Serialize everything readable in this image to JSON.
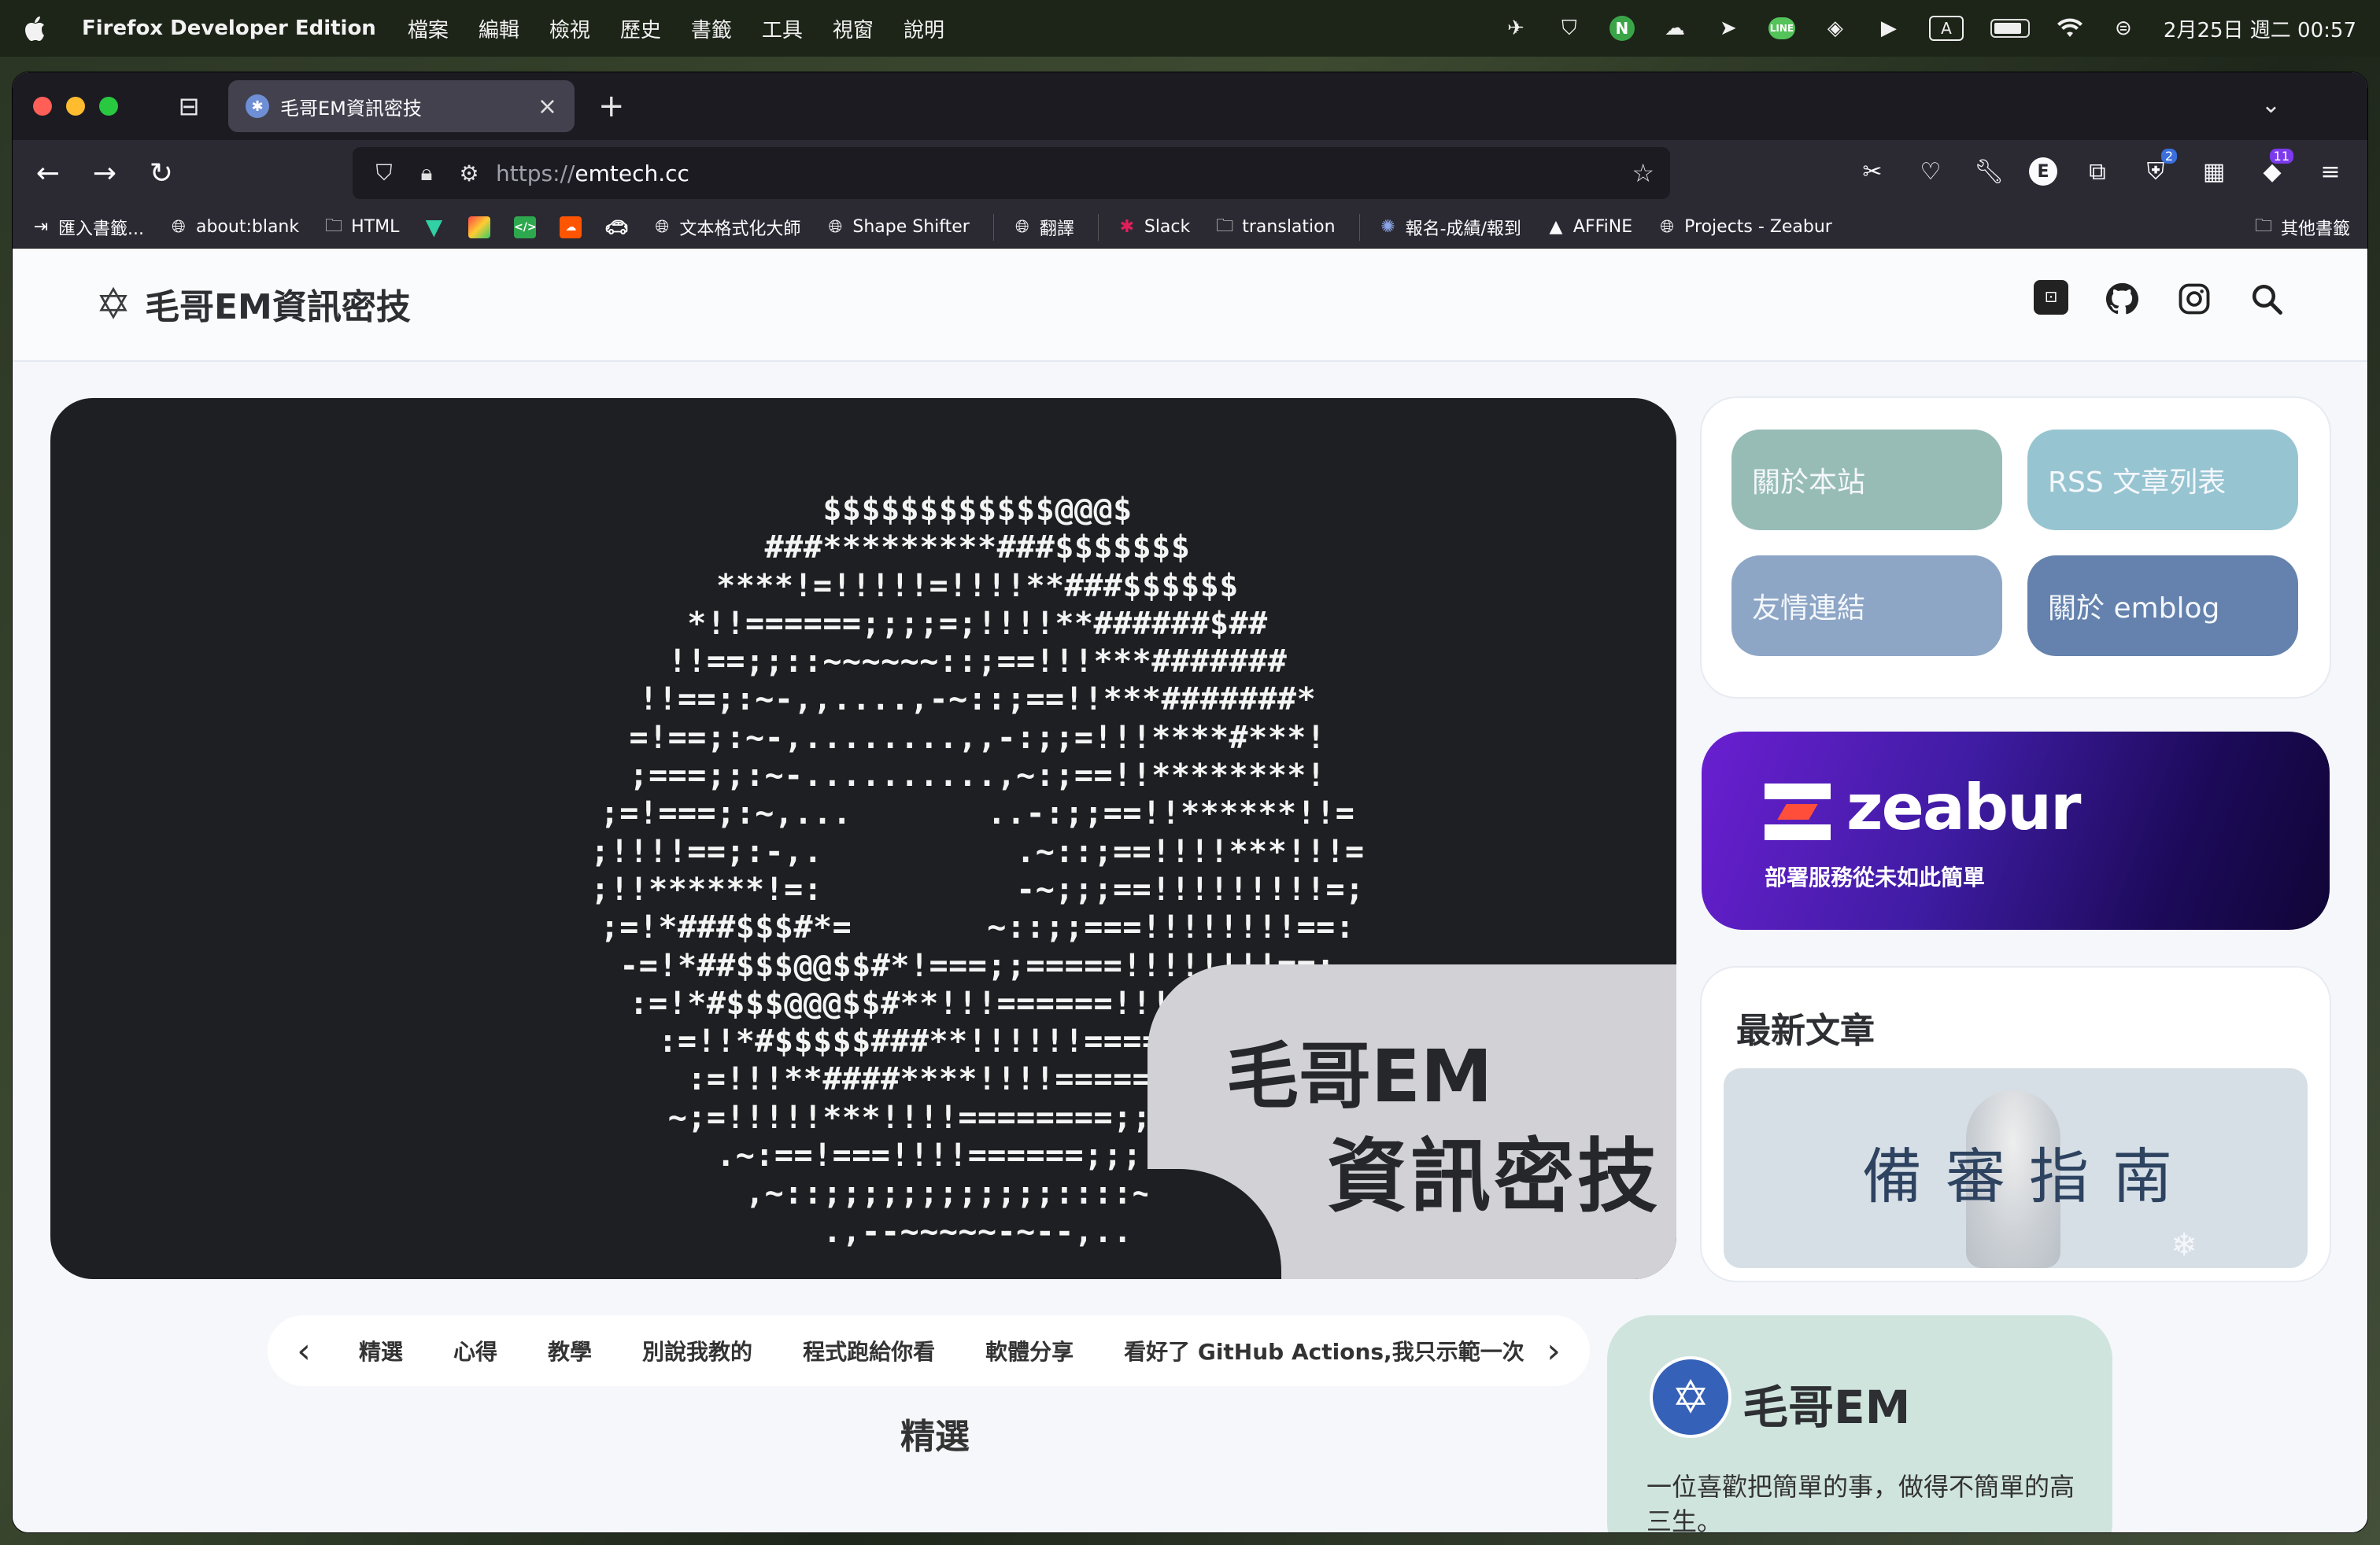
{
  "menubar": {
    "app_name": "Firefox Developer Edition",
    "menus": [
      "檔案",
      "編輯",
      "檢視",
      "歷史",
      "書籤",
      "工具",
      "視窗",
      "說明"
    ],
    "status_icons": [
      "rocket-icon",
      "shield-icon",
      "n-icon",
      "cloud-icon",
      "send-icon",
      "line-icon",
      "layers-icon",
      "play-icon",
      "input-icon",
      "battery-icon",
      "wifi-icon",
      "control-center-icon"
    ],
    "n_letter": "N",
    "line_label": "LINE",
    "input_letter": "A",
    "datetime": "2月25日 週二 00:57"
  },
  "browser": {
    "tab_title": "毛哥EM資訊密技",
    "url_scheme": "https://",
    "url_host": "emtech.cc",
    "toolbar_badges": {
      "bitwarden": "2",
      "extension": "11"
    },
    "toolbar_letter": "E",
    "bookmarks": [
      {
        "label": "匯入書籤...",
        "icon": "import-icon"
      },
      {
        "label": "about:blank",
        "icon": "globe-icon"
      },
      {
        "label": "HTML",
        "icon": "folder-icon"
      },
      {
        "label": "文本格式化大師",
        "icon": "globe-icon"
      },
      {
        "label": "Shape Shifter",
        "icon": "globe-icon"
      },
      {
        "label": "翻譯",
        "icon": "globe-icon"
      },
      {
        "label": "Slack",
        "icon": "slack-icon"
      },
      {
        "label": "translation",
        "icon": "folder-icon"
      },
      {
        "label": "報名-成績/報到",
        "icon": "site-icon"
      },
      {
        "label": "AFFiNE",
        "icon": "affine-icon"
      },
      {
        "label": "Projects - Zeabur",
        "icon": "globe-icon"
      }
    ],
    "other_bookmarks": "其他書籤"
  },
  "site": {
    "logo_text": "毛哥EM資訊密技",
    "hero": {
      "ascii_lines": [
        "$$$$$$$$$$$$@@@$",
        "###*********###$$$$$$$",
        "****!=!!!!!=!!!!**###$$$$$$",
        "*!!======;;;;=;!!!!**######$##",
        "!!==;;::~~~~~~::;==!!!***#######",
        "!!==;:~-,,....,-~::;==!!***#######*",
        "=!==;:~-,........,,-:;;=!!!****#***!",
        ";===;;:~-..........,~:;==!!********!",
        ";=!===;:~,...       ..-:;;==!!******!!=",
        ";!!!!==;:-,.          .~::;==!!!!***!!!=",
        ";!!******!=:          -~;;;==!!!!!!!!!=;",
        ";=!*###$$$#*=       ~::;;===!!!!!!!!==:",
        "-=!*##$$$@@$$#*!===;;=====!!!!!!!!==;",
        ":=!*#$$$@@@$$#**!!!======!!!======;:",
        ":=!!*#$$$$$###**!!!!!!=========;:",
        ":=!!!**####****!!!!========;;:",
        "~;=!!!!!***!!!!========;;;;;;:~,",
        ".~:==!===!!!!======;;;;:::~",
        ",~::;;;;;;;;;;;;::::~--,",
        ".,--~~~~~-~--,.."
      ],
      "title_line1": "毛哥EM",
      "title_line2": "資訊密技"
    },
    "side_links": [
      "關於本站",
      "RSS 文章列表",
      "友情連結",
      "關於 emblog"
    ],
    "ad": {
      "brand": "zeabur",
      "tagline": "部署服務從未如此簡單"
    },
    "latest": {
      "title": "最新文章",
      "card_text": "備審指南"
    },
    "categories": [
      "精選",
      "心得",
      "教學",
      "別說我教的",
      "程式跑給你看",
      "軟體分享",
      "看好了 GitHub Actions,我只示範一次"
    ],
    "section_title": "精選",
    "profile": {
      "name": "毛哥EM",
      "description": "一位喜歡把簡單的事，做得不簡單的高三生。"
    }
  },
  "colors": {
    "accent_purple": "#3f1ca3",
    "link_green": "#97bcb6",
    "link_blue": "#6482ad"
  }
}
